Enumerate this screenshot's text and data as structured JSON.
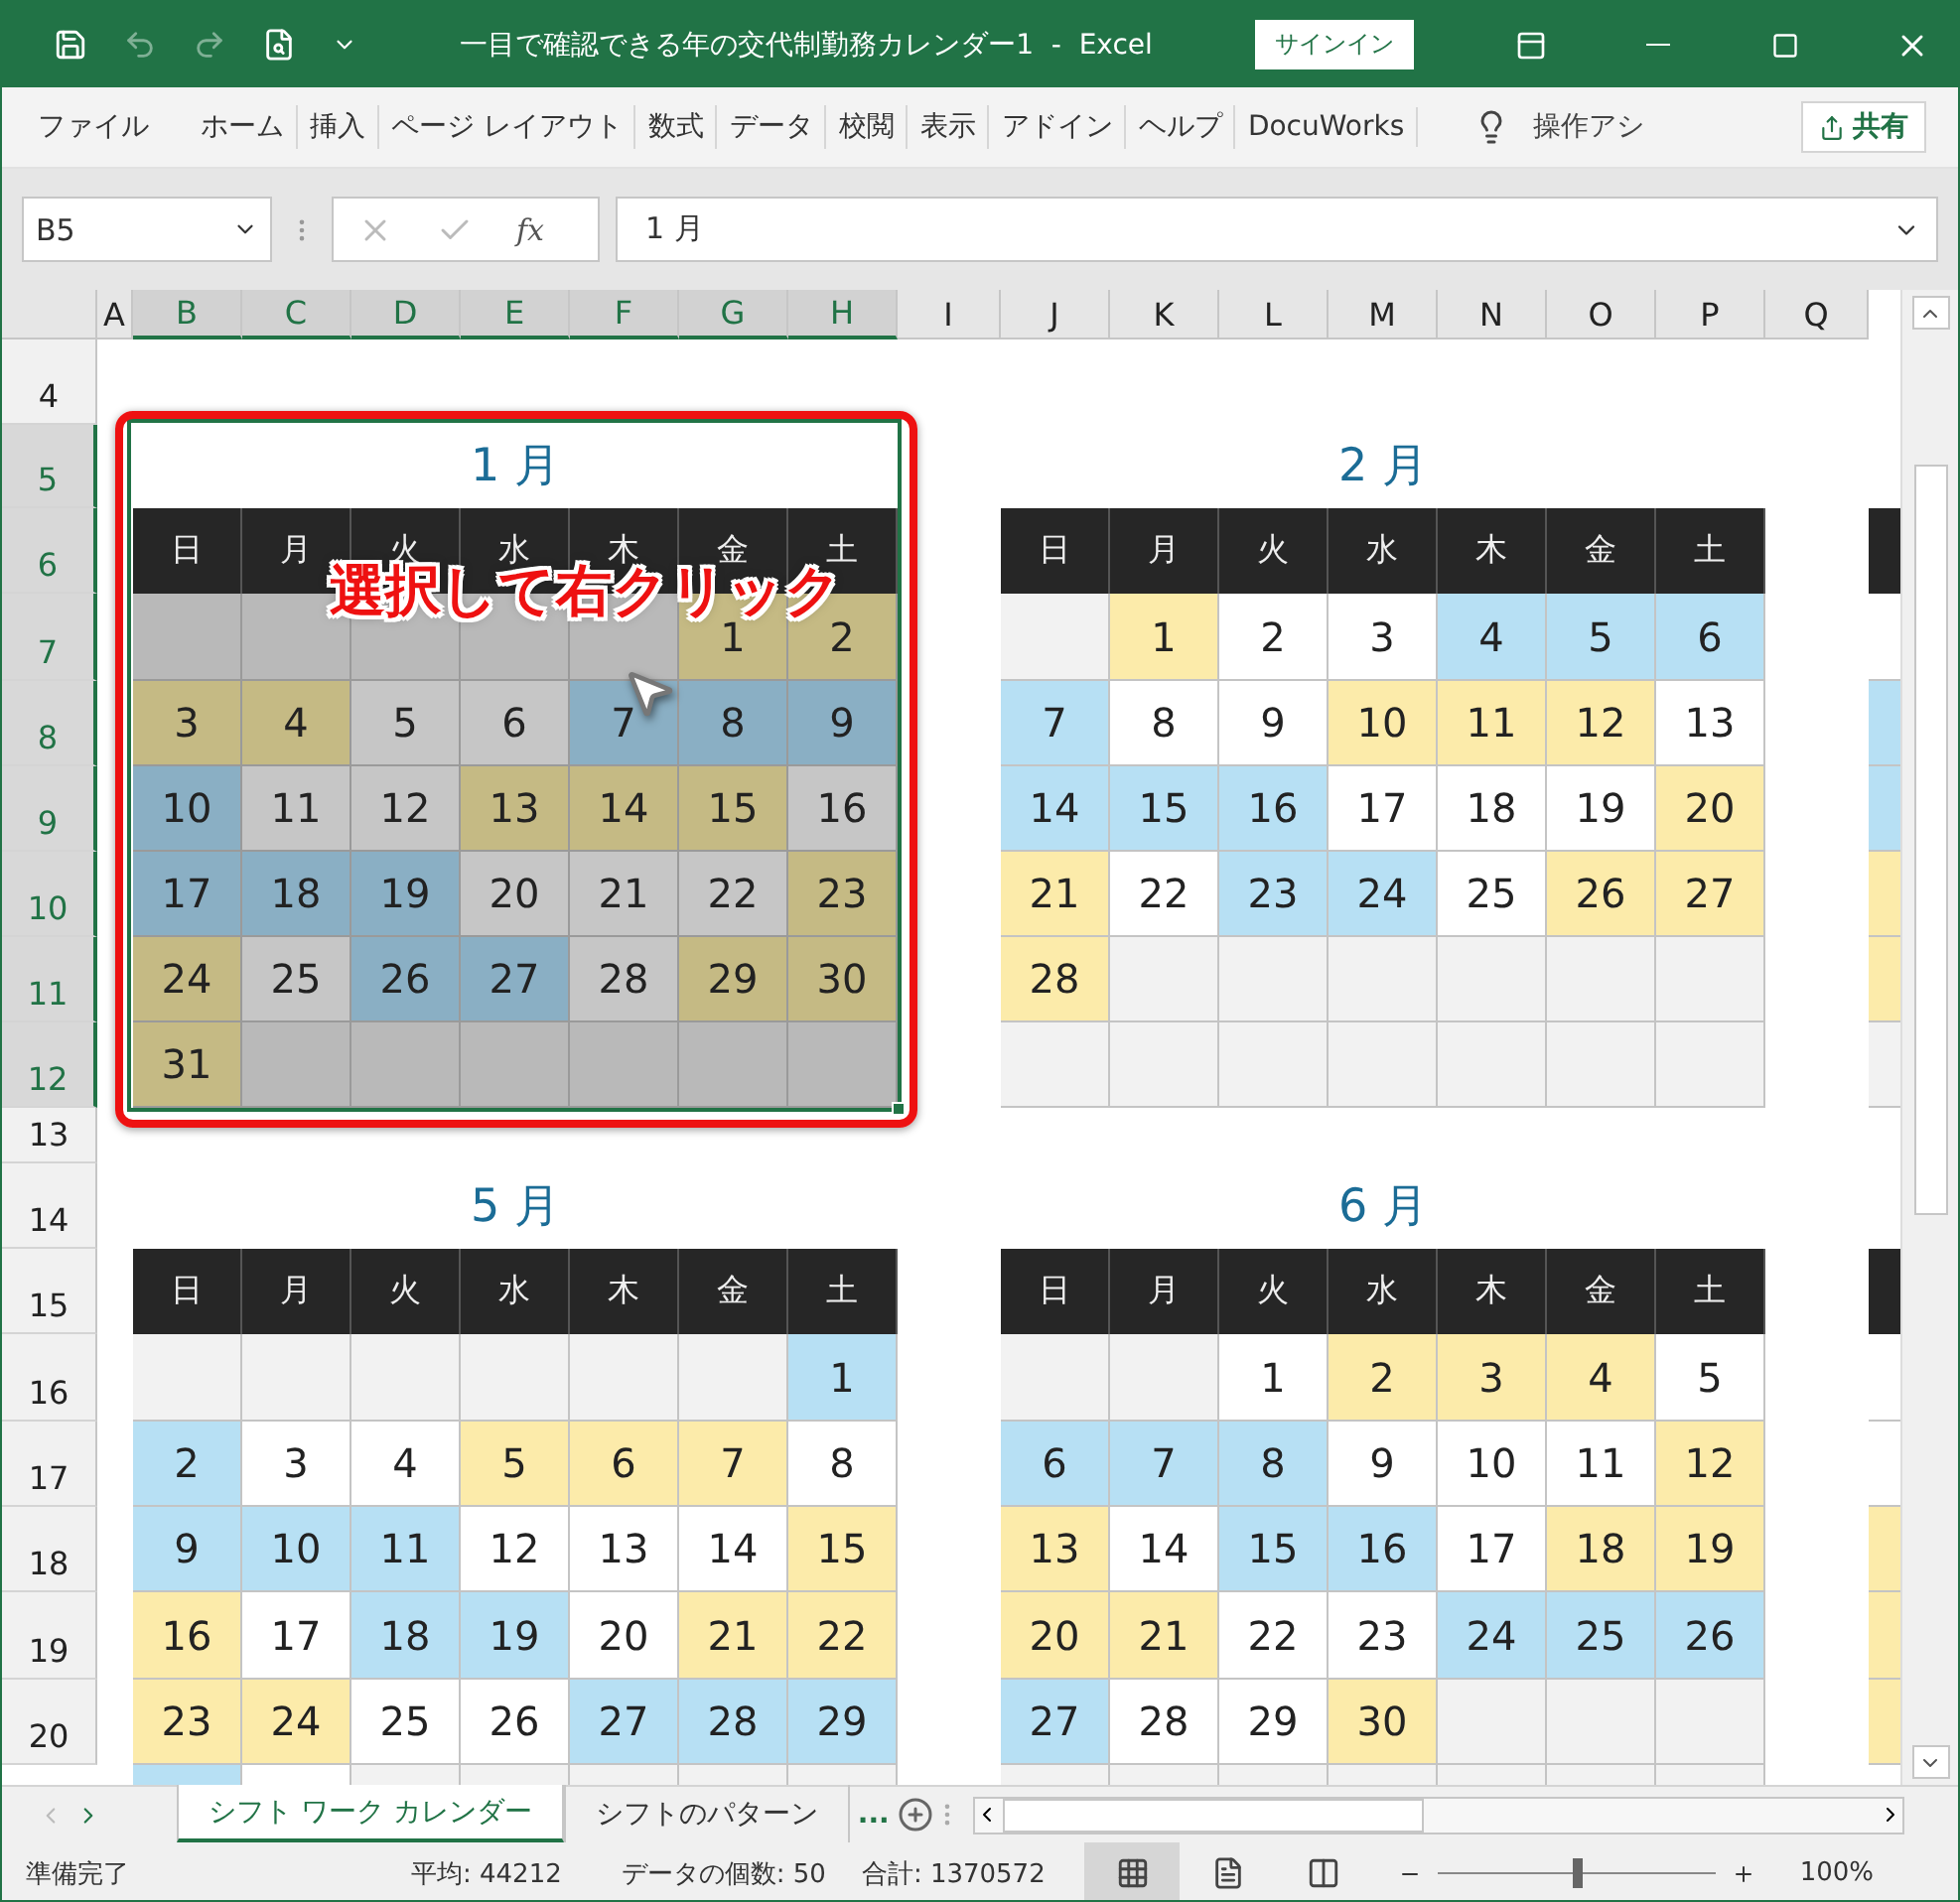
{
  "title_bar": {
    "title": "一目で確認できる年の交代制勤務カレンダー1  -  Excel",
    "sign_in": "サインイン"
  },
  "ribbon_tabs": [
    "ファイル",
    "ホーム",
    "挿入",
    "ページ レイアウト",
    "数式",
    "データ",
    "校閲",
    "表示",
    "アドイン",
    "ヘルプ",
    "DocuWorks"
  ],
  "tell_me": "操作アシ",
  "share": "共有",
  "formula_bar": {
    "name_box": "B5",
    "fx": "fx",
    "value": "1 月"
  },
  "columns": [
    {
      "label": "A",
      "selected": false
    },
    {
      "label": "B",
      "selected": true
    },
    {
      "label": "C",
      "selected": true
    },
    {
      "label": "D",
      "selected": true
    },
    {
      "label": "E",
      "selected": true
    },
    {
      "label": "F",
      "selected": true
    },
    {
      "label": "G",
      "selected": true
    },
    {
      "label": "H",
      "selected": true
    },
    {
      "label": "I",
      "selected": false
    },
    {
      "label": "J",
      "selected": false
    },
    {
      "label": "K",
      "selected": false
    },
    {
      "label": "L",
      "selected": false
    },
    {
      "label": "M",
      "selected": false
    },
    {
      "label": "N",
      "selected": false
    },
    {
      "label": "O",
      "selected": false
    },
    {
      "label": "P",
      "selected": false
    },
    {
      "label": "Q",
      "selected": false
    }
  ],
  "rows": [
    {
      "label": "4",
      "selected": false
    },
    {
      "label": "5",
      "selected": true
    },
    {
      "label": "6",
      "selected": true
    },
    {
      "label": "7",
      "selected": true
    },
    {
      "label": "8",
      "selected": true
    },
    {
      "label": "9",
      "selected": true
    },
    {
      "label": "10",
      "selected": true
    },
    {
      "label": "11",
      "selected": true
    },
    {
      "label": "12",
      "selected": true
    },
    {
      "label": "13",
      "selected": false
    },
    {
      "label": "14",
      "selected": false
    },
    {
      "label": "15",
      "selected": false
    },
    {
      "label": "16",
      "selected": false
    },
    {
      "label": "17",
      "selected": false
    },
    {
      "label": "18",
      "selected": false
    },
    {
      "label": "19",
      "selected": false
    },
    {
      "label": "20",
      "selected": false
    }
  ],
  "calendars": [
    {
      "month": "1 月",
      "selected": true,
      "weekdays": [
        "日",
        "月",
        "火",
        "水",
        "木",
        "金",
        "土"
      ],
      "weeks": [
        [
          {
            "color": "#b9b9b9"
          },
          {
            "color": "#b9b9b9"
          },
          {
            "color": "#b9b9b9"
          },
          {
            "color": "#b9b9b9"
          },
          {
            "color": "#b9b9b9"
          },
          {
            "day": "1",
            "color": "#c5ba84"
          },
          {
            "day": "2",
            "color": "#c5ba84"
          }
        ],
        [
          {
            "day": "3",
            "color": "#c5ba84"
          },
          {
            "day": "4",
            "color": "#c5ba84"
          },
          {
            "day": "5",
            "color": "#c6c6c6"
          },
          {
            "day": "6",
            "color": "#c6c6c6"
          },
          {
            "day": "7",
            "color": "#8aafc4"
          },
          {
            "day": "8",
            "color": "#8aafc4"
          },
          {
            "day": "9",
            "color": "#8aafc4"
          }
        ],
        [
          {
            "day": "10",
            "color": "#8aafc4"
          },
          {
            "day": "11",
            "color": "#c6c6c6"
          },
          {
            "day": "12",
            "color": "#c6c6c6"
          },
          {
            "day": "13",
            "color": "#c5ba84"
          },
          {
            "day": "14",
            "color": "#c5ba84"
          },
          {
            "day": "15",
            "color": "#c5ba84"
          },
          {
            "day": "16",
            "color": "#c6c6c6"
          }
        ],
        [
          {
            "day": "17",
            "color": "#8aafc4"
          },
          {
            "day": "18",
            "color": "#8aafc4"
          },
          {
            "day": "19",
            "color": "#8aafc4"
          },
          {
            "day": "20",
            "color": "#c6c6c6"
          },
          {
            "day": "21",
            "color": "#c6c6c6"
          },
          {
            "day": "22",
            "color": "#c6c6c6"
          },
          {
            "day": "23",
            "color": "#c5ba84"
          }
        ],
        [
          {
            "day": "24",
            "color": "#c5ba84"
          },
          {
            "day": "25",
            "color": "#c6c6c6"
          },
          {
            "day": "26",
            "color": "#8aafc4"
          },
          {
            "day": "27",
            "color": "#8aafc4"
          },
          {
            "day": "28",
            "color": "#c6c6c6"
          },
          {
            "day": "29",
            "color": "#c5ba84"
          },
          {
            "day": "30",
            "color": "#c5ba84"
          }
        ],
        [
          {
            "day": "31",
            "color": "#c5ba84"
          },
          {
            "color": "#b9b9b9"
          },
          {
            "color": "#b9b9b9"
          },
          {
            "color": "#b9b9b9"
          },
          {
            "color": "#b9b9b9"
          },
          {
            "color": "#b9b9b9"
          },
          {
            "color": "#b9b9b9"
          }
        ]
      ]
    },
    {
      "month": "2 月",
      "selected": false,
      "weekdays": [
        "日",
        "月",
        "火",
        "水",
        "木",
        "金",
        "土"
      ],
      "weeks": [
        [
          {
            "color": "#f2f2f2"
          },
          {
            "day": "1",
            "color": "#fcebaa"
          },
          {
            "day": "2",
            "color": "#ffffff"
          },
          {
            "day": "3",
            "color": "#ffffff"
          },
          {
            "day": "4",
            "color": "#b7e0f4"
          },
          {
            "day": "5",
            "color": "#b7e0f4"
          },
          {
            "day": "6",
            "color": "#b7e0f4"
          }
        ],
        [
          {
            "day": "7",
            "color": "#b7e0f4"
          },
          {
            "day": "8",
            "color": "#ffffff"
          },
          {
            "day": "9",
            "color": "#ffffff"
          },
          {
            "day": "10",
            "color": "#fcebaa"
          },
          {
            "day": "11",
            "color": "#fcebaa"
          },
          {
            "day": "12",
            "color": "#fcebaa"
          },
          {
            "day": "13",
            "color": "#ffffff"
          }
        ],
        [
          {
            "day": "14",
            "color": "#b7e0f4"
          },
          {
            "day": "15",
            "color": "#b7e0f4"
          },
          {
            "day": "16",
            "color": "#b7e0f4"
          },
          {
            "day": "17",
            "color": "#ffffff"
          },
          {
            "day": "18",
            "color": "#ffffff"
          },
          {
            "day": "19",
            "color": "#ffffff"
          },
          {
            "day": "20",
            "color": "#fcebaa"
          }
        ],
        [
          {
            "day": "21",
            "color": "#fcebaa"
          },
          {
            "day": "22",
            "color": "#ffffff"
          },
          {
            "day": "23",
            "color": "#b7e0f4"
          },
          {
            "day": "24",
            "color": "#b7e0f4"
          },
          {
            "day": "25",
            "color": "#ffffff"
          },
          {
            "day": "26",
            "color": "#fcebaa"
          },
          {
            "day": "27",
            "color": "#fcebaa"
          }
        ],
        [
          {
            "day": "28",
            "color": "#fcebaa"
          },
          {
            "color": "#f2f2f2"
          },
          {
            "color": "#f2f2f2"
          },
          {
            "color": "#f2f2f2"
          },
          {
            "color": "#f2f2f2"
          },
          {
            "color": "#f2f2f2"
          },
          {
            "color": "#f2f2f2"
          }
        ],
        [
          {
            "color": "#f2f2f2"
          },
          {
            "color": "#f2f2f2"
          },
          {
            "color": "#f2f2f2"
          },
          {
            "color": "#f2f2f2"
          },
          {
            "color": "#f2f2f2"
          },
          {
            "color": "#f2f2f2"
          },
          {
            "color": "#f2f2f2"
          }
        ]
      ]
    },
    {
      "month": "5 月",
      "selected": false,
      "weekdays": [
        "日",
        "月",
        "火",
        "水",
        "木",
        "金",
        "土"
      ],
      "weeks": [
        [
          {
            "color": "#f2f2f2"
          },
          {
            "color": "#f2f2f2"
          },
          {
            "color": "#f2f2f2"
          },
          {
            "color": "#f2f2f2"
          },
          {
            "color": "#f2f2f2"
          },
          {
            "color": "#f2f2f2"
          },
          {
            "day": "1",
            "color": "#b7e0f4"
          }
        ],
        [
          {
            "day": "2",
            "color": "#b7e0f4"
          },
          {
            "day": "3",
            "color": "#ffffff"
          },
          {
            "day": "4",
            "color": "#ffffff"
          },
          {
            "day": "5",
            "color": "#fcebaa"
          },
          {
            "day": "6",
            "color": "#fcebaa"
          },
          {
            "day": "7",
            "color": "#fcebaa"
          },
          {
            "day": "8",
            "color": "#ffffff"
          }
        ],
        [
          {
            "day": "9",
            "color": "#b7e0f4"
          },
          {
            "day": "10",
            "color": "#b7e0f4"
          },
          {
            "day": "11",
            "color": "#b7e0f4"
          },
          {
            "day": "12",
            "color": "#ffffff"
          },
          {
            "day": "13",
            "color": "#ffffff"
          },
          {
            "day": "14",
            "color": "#ffffff"
          },
          {
            "day": "15",
            "color": "#fcebaa"
          }
        ],
        [
          {
            "day": "16",
            "color": "#fcebaa"
          },
          {
            "day": "17",
            "color": "#ffffff"
          },
          {
            "day": "18",
            "color": "#b7e0f4"
          },
          {
            "day": "19",
            "color": "#b7e0f4"
          },
          {
            "day": "20",
            "color": "#ffffff"
          },
          {
            "day": "21",
            "color": "#fcebaa"
          },
          {
            "day": "22",
            "color": "#fcebaa"
          }
        ],
        [
          {
            "day": "23",
            "color": "#fcebaa"
          },
          {
            "day": "24",
            "color": "#fcebaa"
          },
          {
            "day": "25",
            "color": "#ffffff"
          },
          {
            "day": "26",
            "color": "#ffffff"
          },
          {
            "day": "27",
            "color": "#b7e0f4"
          },
          {
            "day": "28",
            "color": "#b7e0f4"
          },
          {
            "day": "29",
            "color": "#b7e0f4"
          }
        ],
        [
          {
            "color": "#b7e0f4"
          },
          {
            "color": "#ffffff"
          },
          {
            "color": "#f2f2f2"
          },
          {
            "color": "#f2f2f2"
          },
          {
            "color": "#f2f2f2"
          },
          {
            "color": "#f2f2f2"
          },
          {
            "color": "#f2f2f2"
          }
        ]
      ]
    },
    {
      "month": "6 月",
      "selected": false,
      "weekdays": [
        "日",
        "月",
        "火",
        "水",
        "木",
        "金",
        "土"
      ],
      "weeks": [
        [
          {
            "color": "#f2f2f2"
          },
          {
            "color": "#f2f2f2"
          },
          {
            "day": "1",
            "color": "#ffffff"
          },
          {
            "day": "2",
            "color": "#fcebaa"
          },
          {
            "day": "3",
            "color": "#fcebaa"
          },
          {
            "day": "4",
            "color": "#fcebaa"
          },
          {
            "day": "5",
            "color": "#ffffff"
          }
        ],
        [
          {
            "day": "6",
            "color": "#b7e0f4"
          },
          {
            "day": "7",
            "color": "#b7e0f4"
          },
          {
            "day": "8",
            "color": "#b7e0f4"
          },
          {
            "day": "9",
            "color": "#ffffff"
          },
          {
            "day": "10",
            "color": "#ffffff"
          },
          {
            "day": "11",
            "color": "#ffffff"
          },
          {
            "day": "12",
            "color": "#fcebaa"
          }
        ],
        [
          {
            "day": "13",
            "color": "#fcebaa"
          },
          {
            "day": "14",
            "color": "#ffffff"
          },
          {
            "day": "15",
            "color": "#b7e0f4"
          },
          {
            "day": "16",
            "color": "#b7e0f4"
          },
          {
            "day": "17",
            "color": "#ffffff"
          },
          {
            "day": "18",
            "color": "#fcebaa"
          },
          {
            "day": "19",
            "color": "#fcebaa"
          }
        ],
        [
          {
            "day": "20",
            "color": "#fcebaa"
          },
          {
            "day": "21",
            "color": "#fcebaa"
          },
          {
            "day": "22",
            "color": "#ffffff"
          },
          {
            "day": "23",
            "color": "#ffffff"
          },
          {
            "day": "24",
            "color": "#b7e0f4"
          },
          {
            "day": "25",
            "color": "#b7e0f4"
          },
          {
            "day": "26",
            "color": "#b7e0f4"
          }
        ],
        [
          {
            "day": "27",
            "color": "#b7e0f4"
          },
          {
            "day": "28",
            "color": "#ffffff"
          },
          {
            "day": "29",
            "color": "#ffffff"
          },
          {
            "day": "30",
            "color": "#fcebaa"
          },
          {
            "color": "#f2f2f2"
          },
          {
            "color": "#f2f2f2"
          },
          {
            "color": "#f2f2f2"
          }
        ],
        [
          {
            "color": "#f2f2f2"
          },
          {
            "color": "#f2f2f2"
          },
          {
            "color": "#f2f2f2"
          },
          {
            "color": "#f2f2f2"
          },
          {
            "color": "#f2f2f2"
          },
          {
            "color": "#f2f2f2"
          },
          {
            "color": "#f2f2f2"
          }
        ]
      ]
    }
  ],
  "edge_calendars": [
    {
      "cells": [
        {
          "color": "#ffffff"
        },
        {
          "color": "#b7e0f4"
        },
        {
          "color": "#b7e0f4"
        },
        {
          "color": "#fcebaa"
        },
        {
          "color": "#fcebaa"
        },
        {
          "color": "#f2f2f2"
        }
      ]
    },
    {
      "cells": [
        {
          "color": "#ffffff"
        },
        {
          "color": "#ffffff"
        },
        {
          "color": "#fcebaa"
        },
        {
          "color": "#fcebaa"
        },
        {
          "color": "#fcebaa"
        }
      ]
    }
  ],
  "annotation": {
    "text": "選択して右クリック"
  },
  "sheet_tabs": [
    {
      "label": "シフト ワーク カレンダー",
      "selected": true
    },
    {
      "label": "シフトのパターン",
      "selected": false
    }
  ],
  "more_tabs": "...",
  "status_bar": {
    "ready": "準備完了",
    "average": "平均: 44212",
    "count": "データの個数: 50",
    "sum": "合計: 1370572",
    "zoom": "100%"
  },
  "views": [
    {
      "kind": "normal",
      "selected": true
    },
    {
      "kind": "page_layout",
      "selected": false
    },
    {
      "kind": "page_break",
      "selected": false
    }
  ],
  "zoom_slider": {
    "level": 0.5
  }
}
